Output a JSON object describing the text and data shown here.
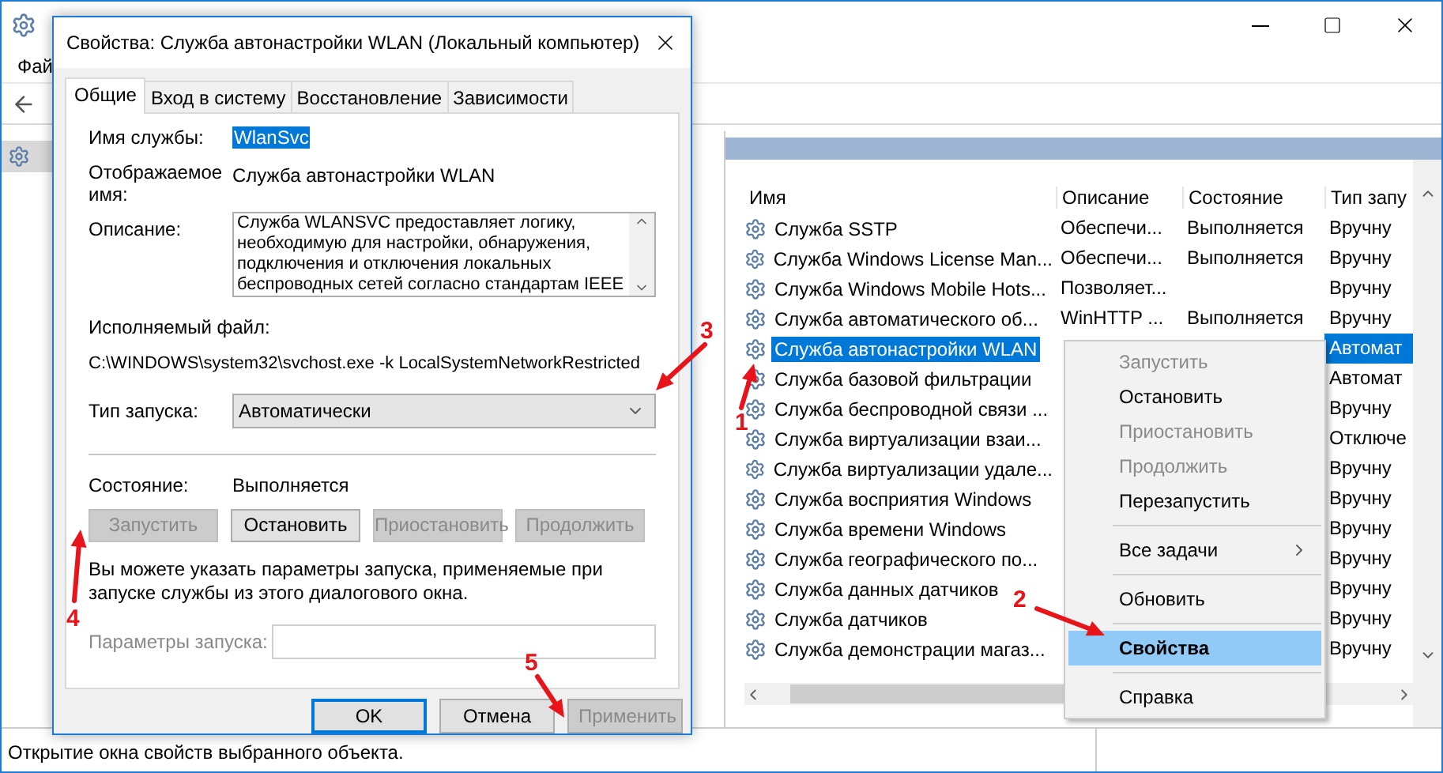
{
  "main_window": {
    "menu": [
      "Фай"
    ],
    "tree": [
      {
        "selected": true
      }
    ],
    "columns": [
      "Имя",
      "Описание",
      "Состояние",
      "Тип запу"
    ],
    "rows": [
      {
        "name": "Служба SSTP",
        "description": "Обеспечи...",
        "state": "Выполняется",
        "startup": "Вручну",
        "selected": false
      },
      {
        "name": "Служба Windows License Man...",
        "description": "Обеспечи...",
        "state": "Выполняется",
        "startup": "Вручну",
        "selected": false
      },
      {
        "name": "Служба Windows Mobile Hots...",
        "description": "Позволяет...",
        "startup": "Вручну",
        "selected": false
      },
      {
        "name": "Служба автоматического об...",
        "description": "WinHTTP ...",
        "state": "Выполняется",
        "startup": "Вручну",
        "selected": false
      },
      {
        "name": "Служба автонастройки WLAN",
        "startup": "Автомат",
        "selected": true
      },
      {
        "name": "Служба базовой фильтрации",
        "startup": "Автомат",
        "selected": false
      },
      {
        "name": "Служба беспроводной связи ...",
        "startup": "Вручну",
        "selected": false
      },
      {
        "name": "Служба виртуализации взаи...",
        "startup": "Отключе",
        "selected": false
      },
      {
        "name": "Служба виртуализации удале...",
        "startup": "Вручну",
        "selected": false
      },
      {
        "name": "Служба восприятия Windows",
        "startup": "Вручну",
        "selected": false
      },
      {
        "name": "Служба времени Windows",
        "startup": "Вручну",
        "selected": false
      },
      {
        "name": "Служба географического по...",
        "startup": "Вручну",
        "selected": false
      },
      {
        "name": "Служба данных датчиков",
        "startup": "Вручну",
        "selected": false
      },
      {
        "name": "Служба датчиков",
        "startup": "Вручну",
        "selected": false
      },
      {
        "name": "Служба демонстрации магаз...",
        "startup": "Вручну",
        "selected": false
      }
    ],
    "status_bar": "Открытие окна свойств выбранного объекта."
  },
  "context_menu": {
    "items": [
      {
        "kind": "item",
        "label": "Запустить",
        "disabled": true,
        "selected": false
      },
      {
        "kind": "item",
        "label": "Остановить",
        "disabled": false,
        "selected": false
      },
      {
        "kind": "item",
        "label": "Приостановить",
        "disabled": true,
        "selected": false
      },
      {
        "kind": "item",
        "label": "Продолжить",
        "disabled": true,
        "selected": false
      },
      {
        "kind": "item",
        "label": "Перезапустить",
        "disabled": false,
        "selected": false
      },
      {
        "kind": "separator"
      },
      {
        "kind": "submenu",
        "label": "Все задачи",
        "disabled": false,
        "selected": false
      },
      {
        "kind": "separator"
      },
      {
        "kind": "item",
        "label": "Обновить",
        "disabled": false,
        "selected": false
      },
      {
        "kind": "separator"
      },
      {
        "kind": "item",
        "label": "Свойства",
        "disabled": false,
        "selected": true
      },
      {
        "kind": "separator"
      },
      {
        "kind": "item",
        "label": "Справка",
        "disabled": false,
        "selected": false
      }
    ]
  },
  "dialog": {
    "title": "Свойства: Служба автонастройки WLAN (Локальный компьютер)",
    "tabs": [
      {
        "label": "Общие",
        "selected": true
      },
      {
        "label": "Вход в систему",
        "selected": false
      },
      {
        "label": "Восстановление",
        "selected": false
      },
      {
        "label": "Зависимости",
        "selected": false
      }
    ],
    "service_name_label": "Имя службы:",
    "service_name": "WlanSvc",
    "display_name_label": "Отображаемое имя:",
    "display_name": "Служба автонастройки WLAN",
    "description_label": "Описание:",
    "description": "Служба WLANSVC предоставляет логику, необходимую для настройки, обнаружения, подключения и отключения локальных беспроводных сетей согласно стандартам IEEE",
    "executable_label": "Исполняемый файл:",
    "executable": "C:\\WINDOWS\\system32\\svchost.exe -k LocalSystemNetworkRestricted",
    "startup_type_label": "Тип запуска:",
    "startup_type": "Автоматически",
    "status_label": "Состояние:",
    "status": "Выполняется",
    "service_buttons": [
      {
        "label": "Запустить",
        "disabled": true
      },
      {
        "label": "Остановить",
        "disabled": false
      },
      {
        "label": "Приостановить",
        "disabled": true
      },
      {
        "label": "Продолжить",
        "disabled": true
      }
    ],
    "hint": "Вы можете указать параметры запуска, применяемые при запуске службы из этого диалогового окна.",
    "params_label": "Параметры запуска:",
    "params_disabled": true,
    "footer_buttons": [
      {
        "label": "OK",
        "disabled": false,
        "default": true
      },
      {
        "label": "Отмена",
        "disabled": false,
        "default": false
      },
      {
        "label": "Применить",
        "disabled": true,
        "default": false
      }
    ]
  },
  "annotations": [
    "1",
    "2",
    "3",
    "4",
    "5"
  ]
}
